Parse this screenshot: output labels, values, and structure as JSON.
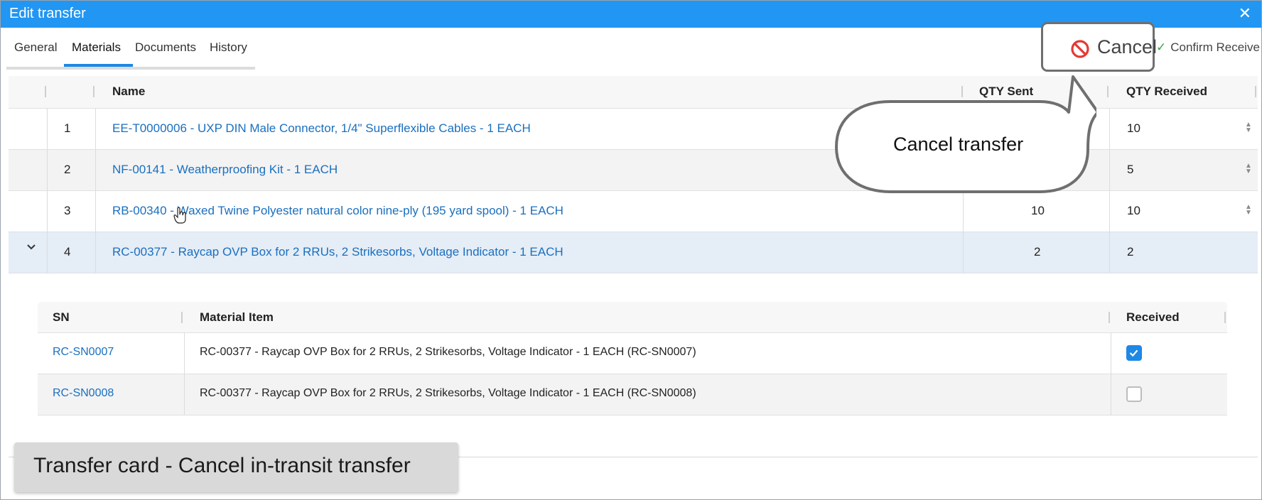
{
  "window": {
    "title": "Edit transfer",
    "close_glyph": "✕"
  },
  "tabs": [
    {
      "label": "General",
      "active": false
    },
    {
      "label": "Materials",
      "active": true
    },
    {
      "label": "Documents",
      "active": false
    },
    {
      "label": "History",
      "active": false
    }
  ],
  "toolbar": {
    "cancel_label": "Cancel",
    "cancel_icon": "no-entry-icon",
    "confirm_check": "✓",
    "confirm_label": "Confirm Receive"
  },
  "materials_table": {
    "headers": {
      "name": "Name",
      "qty_sent": "QTY Sent",
      "qty_received": "QTY Received"
    },
    "rows": [
      {
        "num": "1",
        "name": "EE-T0000006 - UXP DIN Male Connector, 1/4\" Superflexible Cables - 1 EACH",
        "qty_sent": "",
        "qty_received": "10"
      },
      {
        "num": "2",
        "name": "NF-00141 - Weatherproofing Kit - 1 EACH",
        "qty_sent": "",
        "qty_received": "5"
      },
      {
        "num": "3",
        "name": "RB-00340 - Waxed Twine Polyester natural color nine-ply (195 yard spool) - 1 EACH",
        "qty_sent": "10",
        "qty_received": "10"
      },
      {
        "num": "4",
        "name": "RC-00377 - Raycap OVP Box for 2 RRUs, 2 Strikesorbs, Voltage Indicator - 1 EACH",
        "qty_sent": "2",
        "qty_received": "2",
        "expanded": true
      }
    ]
  },
  "serial_table": {
    "headers": {
      "sn": "SN",
      "material_item": "Material Item",
      "received": "Received"
    },
    "rows": [
      {
        "sn": "RC-SN0007",
        "material_item": "RC-00377 - Raycap OVP Box for 2 RRUs, 2 Strikesorbs, Voltage Indicator - 1 EACH (RC-SN0007)",
        "received": true
      },
      {
        "sn": "RC-SN0008",
        "material_item": "RC-00377 - Raycap OVP Box for 2 RRUs, 2 Strikesorbs, Voltage Indicator - 1 EACH (RC-SN0008)",
        "received": false
      }
    ]
  },
  "callout": {
    "text": "Cancel transfer"
  },
  "caption": {
    "text": "Transfer card - Cancel in-transit transfer"
  },
  "colors": {
    "titlebar": "#2196f3",
    "link": "#1a6fbf",
    "accent": "#1e88e5",
    "cancel_icon": "#e53935"
  }
}
